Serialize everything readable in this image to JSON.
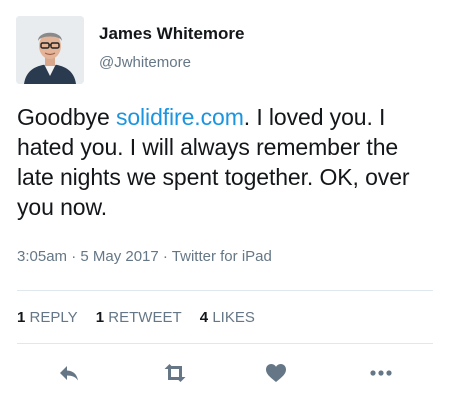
{
  "author": {
    "display_name": "James Whitemore",
    "handle": "@Jwhitemore"
  },
  "tweet": {
    "text_before_link": "Goodbye ",
    "link_text": "solidfire.com",
    "text_after_link": ".  I loved you.  I hated you.  I will always remember the late nights we spent together.  OK, over you now."
  },
  "meta": {
    "timestamp": "3:05am · 5 May 2017 · Twitter for iPad"
  },
  "stats": [
    {
      "count": "1",
      "label": "REPLY"
    },
    {
      "count": "1",
      "label": "RETWEET"
    },
    {
      "count": "4",
      "label": "LIKES"
    }
  ],
  "actions": [
    "reply-icon",
    "retweet-icon",
    "heart-icon",
    "more-icon"
  ],
  "colors": {
    "link": "#1b95e0",
    "secondary_text": "#657786",
    "action_icon": "#657786",
    "divider": "#e1e8ed"
  }
}
